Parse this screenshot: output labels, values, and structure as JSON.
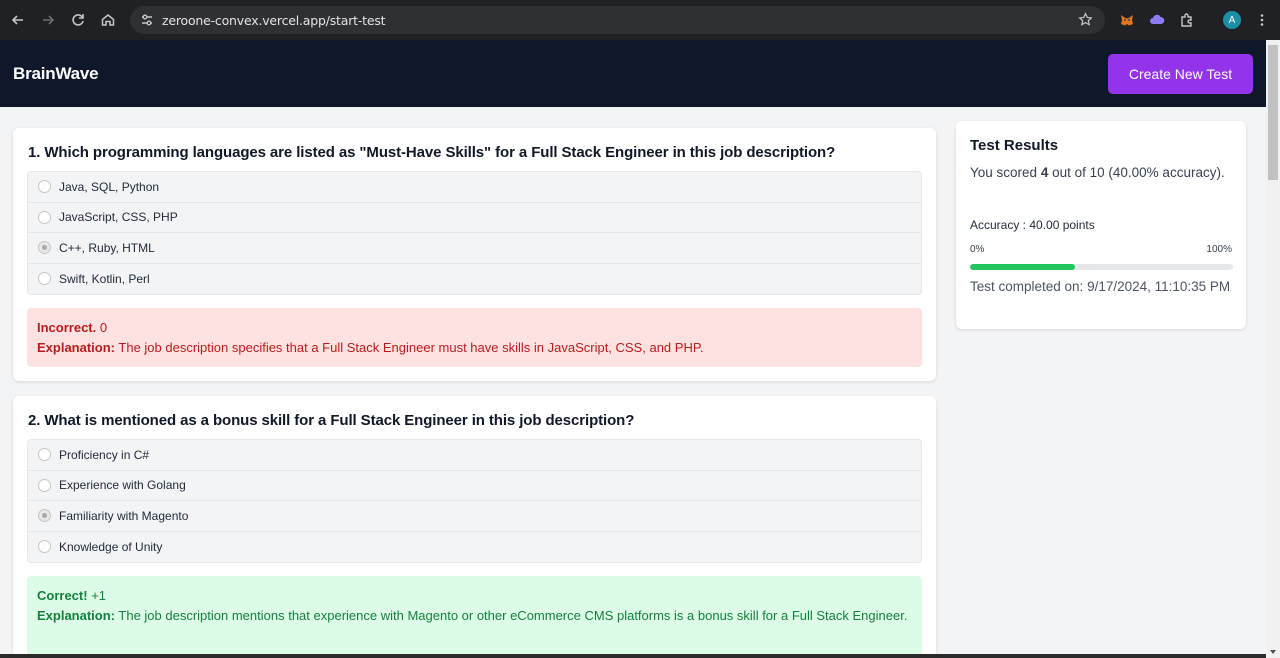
{
  "browser": {
    "url": "zeroone-convex.vercel.app/start-test",
    "back_icon": "arrow-left-icon",
    "forward_icon": "arrow-right-icon",
    "reload_icon": "reload-icon",
    "home_icon": "home-icon",
    "avatar_initial": "A"
  },
  "app": {
    "brand": "BrainWave",
    "create_button": "Create New Test",
    "accent_color": "#9333ea"
  },
  "questions": [
    {
      "title": "1. Which programming languages are listed as \"Must-Have Skills\" for a Full Stack Engineer in this job description?",
      "options": [
        "Java, SQL, Python",
        "JavaScript, CSS, PHP",
        "C++, Ruby, HTML",
        "Swift, Kotlin, Perl"
      ],
      "selected_index": 2,
      "status": "Incorrect.",
      "points": "0",
      "explanation_label": "Explanation:",
      "explanation": "The job description specifies that a Full Stack Engineer must have skills in JavaScript, CSS, and PHP."
    },
    {
      "title": "2. What is mentioned as a bonus skill for a Full Stack Engineer in this job description?",
      "options": [
        "Proficiency in C#",
        "Experience with Golang",
        "Familiarity with Magento",
        "Knowledge of Unity"
      ],
      "selected_index": 2,
      "status": "Correct!",
      "points": "+1",
      "explanation_label": "Explanation:",
      "explanation": "The job description mentions that experience with Magento or other eCommerce CMS platforms is a bonus skill for a Full Stack Engineer."
    }
  ],
  "results": {
    "title": "Test Results",
    "score_prefix": "You scored",
    "score": "4",
    "score_suffix": "out of 10 (40.00% accuracy).",
    "accuracy_label": "Accuracy : 40.00 points",
    "progress_min": "0%",
    "progress_max": "100%",
    "progress_value": 0.4,
    "completed": "Test completed on: 9/17/2024, 11:10:35 PM",
    "progress_color": "#22c55e"
  }
}
